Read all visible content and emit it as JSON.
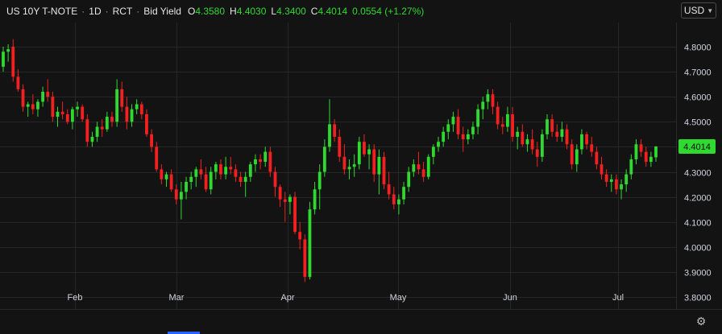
{
  "header": {
    "symbol": "US 10Y T-NOTE",
    "interval": "1D",
    "source": "RCT",
    "price_type": "Bid Yield",
    "open_label": "O",
    "open": "4.3580",
    "high_label": "H",
    "high": "4.4030",
    "low_label": "L",
    "low": "4.3400",
    "close_label": "C",
    "close": "4.4014",
    "change": "0.0554 (+1.27%)",
    "up_color": "#2fd92f",
    "down_color": "#f22020"
  },
  "currency": {
    "label": "USD"
  },
  "settings": {
    "icon": "gear-icon"
  },
  "chart_data": {
    "type": "candlestick",
    "ylim": [
      3.77,
      4.84
    ],
    "y_ticks": [
      "4.8000",
      "4.7000",
      "4.6000",
      "4.5000",
      "4.4000",
      "4.3000",
      "4.2000",
      "4.1000",
      "4.0000",
      "3.9000",
      "3.8000"
    ],
    "x_ticks": [
      "Feb",
      "Mar",
      "Apr",
      "May",
      "Jun",
      "Jul"
    ],
    "last_price_label": "4.4014",
    "last_price": 4.4014,
    "candles": [
      [
        4.72,
        4.8,
        4.7,
        4.78
      ],
      [
        4.78,
        4.81,
        4.74,
        4.79
      ],
      [
        4.8,
        4.83,
        4.66,
        4.68
      ],
      [
        4.68,
        4.71,
        4.62,
        4.63
      ],
      [
        4.63,
        4.65,
        4.54,
        4.56
      ],
      [
        4.56,
        4.58,
        4.52,
        4.57
      ],
      [
        4.57,
        4.61,
        4.53,
        4.55
      ],
      [
        4.55,
        4.59,
        4.52,
        4.58
      ],
      [
        4.58,
        4.64,
        4.56,
        4.62
      ],
      [
        4.62,
        4.67,
        4.58,
        4.6
      ],
      [
        4.6,
        4.62,
        4.5,
        4.52
      ],
      [
        4.52,
        4.56,
        4.48,
        4.54
      ],
      [
        4.54,
        4.58,
        4.51,
        4.53
      ],
      [
        4.53,
        4.55,
        4.49,
        4.5
      ],
      [
        4.5,
        4.56,
        4.47,
        4.55
      ],
      [
        4.55,
        4.58,
        4.52,
        4.56
      ],
      [
        4.56,
        4.57,
        4.5,
        4.51
      ],
      [
        4.51,
        4.53,
        4.4,
        4.42
      ],
      [
        4.42,
        4.46,
        4.4,
        4.44
      ],
      [
        4.44,
        4.5,
        4.42,
        4.48
      ],
      [
        4.48,
        4.51,
        4.44,
        4.47
      ],
      [
        4.47,
        4.54,
        4.46,
        4.52
      ],
      [
        4.52,
        4.54,
        4.48,
        4.5
      ],
      [
        4.5,
        4.67,
        4.48,
        4.63
      ],
      [
        4.63,
        4.66,
        4.54,
        4.56
      ],
      [
        4.56,
        4.6,
        4.47,
        4.5
      ],
      [
        4.5,
        4.57,
        4.48,
        4.55
      ],
      [
        4.55,
        4.59,
        4.53,
        4.57
      ],
      [
        4.57,
        4.58,
        4.51,
        4.53
      ],
      [
        4.53,
        4.55,
        4.44,
        4.45
      ],
      [
        4.45,
        4.47,
        4.38,
        4.4
      ],
      [
        4.4,
        4.42,
        4.3,
        4.31
      ],
      [
        4.31,
        4.33,
        4.25,
        4.27
      ],
      [
        4.27,
        4.3,
        4.24,
        4.29
      ],
      [
        4.29,
        4.31,
        4.22,
        4.23
      ],
      [
        4.23,
        4.25,
        4.17,
        4.19
      ],
      [
        4.19,
        4.26,
        4.11,
        4.22
      ],
      [
        4.22,
        4.28,
        4.19,
        4.26
      ],
      [
        4.26,
        4.3,
        4.23,
        4.28
      ],
      [
        4.28,
        4.32,
        4.24,
        4.31
      ],
      [
        4.31,
        4.35,
        4.27,
        4.29
      ],
      [
        4.29,
        4.32,
        4.22,
        4.23
      ],
      [
        4.23,
        4.32,
        4.21,
        4.3
      ],
      [
        4.3,
        4.34,
        4.27,
        4.33
      ],
      [
        4.33,
        4.35,
        4.27,
        4.29
      ],
      [
        4.29,
        4.36,
        4.27,
        4.32
      ],
      [
        4.32,
        4.36,
        4.29,
        4.31
      ],
      [
        4.31,
        4.33,
        4.26,
        4.28
      ],
      [
        4.28,
        4.3,
        4.24,
        4.26
      ],
      [
        4.26,
        4.3,
        4.2,
        4.28
      ],
      [
        4.28,
        4.34,
        4.26,
        4.33
      ],
      [
        4.33,
        4.37,
        4.3,
        4.35
      ],
      [
        4.35,
        4.37,
        4.31,
        4.34
      ],
      [
        4.34,
        4.4,
        4.32,
        4.38
      ],
      [
        4.38,
        4.4,
        4.28,
        4.3
      ],
      [
        4.3,
        4.32,
        4.2,
        4.24
      ],
      [
        4.24,
        4.25,
        4.16,
        4.19
      ],
      [
        4.19,
        4.22,
        4.1,
        4.18
      ],
      [
        4.18,
        4.21,
        4.13,
        4.2
      ],
      [
        4.2,
        4.22,
        4.05,
        4.06
      ],
      [
        4.06,
        4.1,
        3.99,
        4.03
      ],
      [
        4.03,
        4.05,
        3.86,
        3.88
      ],
      [
        3.88,
        4.18,
        3.87,
        4.15
      ],
      [
        4.15,
        4.26,
        4.13,
        4.23
      ],
      [
        4.23,
        4.33,
        4.15,
        4.3
      ],
      [
        4.3,
        4.43,
        4.28,
        4.4
      ],
      [
        4.4,
        4.59,
        4.38,
        4.49
      ],
      [
        4.49,
        4.51,
        4.42,
        4.44
      ],
      [
        4.44,
        4.47,
        4.34,
        4.36
      ],
      [
        4.36,
        4.41,
        4.29,
        4.31
      ],
      [
        4.31,
        4.35,
        4.27,
        4.32
      ],
      [
        4.32,
        4.37,
        4.28,
        4.33
      ],
      [
        4.33,
        4.44,
        4.31,
        4.42
      ],
      [
        4.42,
        4.45,
        4.36,
        4.37
      ],
      [
        4.37,
        4.41,
        4.31,
        4.39
      ],
      [
        4.39,
        4.41,
        4.26,
        4.29
      ],
      [
        4.29,
        4.39,
        4.21,
        4.36
      ],
      [
        4.36,
        4.38,
        4.23,
        4.25
      ],
      [
        4.25,
        4.3,
        4.19,
        4.21
      ],
      [
        4.21,
        4.24,
        4.15,
        4.17
      ],
      [
        4.17,
        4.21,
        4.13,
        4.19
      ],
      [
        4.19,
        4.26,
        4.17,
        4.24
      ],
      [
        4.24,
        4.32,
        4.22,
        4.3
      ],
      [
        4.3,
        4.35,
        4.28,
        4.33
      ],
      [
        4.33,
        4.38,
        4.29,
        4.31
      ],
      [
        4.31,
        4.34,
        4.26,
        4.28
      ],
      [
        4.28,
        4.37,
        4.27,
        4.36
      ],
      [
        4.36,
        4.41,
        4.33,
        4.4
      ],
      [
        4.4,
        4.44,
        4.38,
        4.42
      ],
      [
        4.42,
        4.48,
        4.4,
        4.46
      ],
      [
        4.46,
        4.51,
        4.43,
        4.49
      ],
      [
        4.49,
        4.54,
        4.46,
        4.52
      ],
      [
        4.52,
        4.55,
        4.43,
        4.45
      ],
      [
        4.45,
        4.48,
        4.38,
        4.43
      ],
      [
        4.43,
        4.47,
        4.41,
        4.45
      ],
      [
        4.45,
        4.5,
        4.43,
        4.48
      ],
      [
        4.48,
        4.57,
        4.45,
        4.55
      ],
      [
        4.55,
        4.6,
        4.51,
        4.58
      ],
      [
        4.58,
        4.63,
        4.55,
        4.61
      ],
      [
        4.61,
        4.63,
        4.53,
        4.56
      ],
      [
        4.56,
        4.58,
        4.47,
        4.49
      ],
      [
        4.49,
        4.52,
        4.45,
        4.48
      ],
      [
        4.48,
        4.56,
        4.46,
        4.53
      ],
      [
        4.53,
        4.56,
        4.42,
        4.44
      ],
      [
        4.44,
        4.48,
        4.39,
        4.46
      ],
      [
        4.46,
        4.49,
        4.4,
        4.41
      ],
      [
        4.41,
        4.45,
        4.38,
        4.43
      ],
      [
        4.43,
        4.47,
        4.37,
        4.39
      ],
      [
        4.39,
        4.42,
        4.32,
        4.36
      ],
      [
        4.36,
        4.47,
        4.34,
        4.45
      ],
      [
        4.45,
        4.53,
        4.43,
        4.51
      ],
      [
        4.51,
        4.53,
        4.44,
        4.46
      ],
      [
        4.46,
        4.49,
        4.42,
        4.44
      ],
      [
        4.44,
        4.5,
        4.42,
        4.47
      ],
      [
        4.47,
        4.49,
        4.39,
        4.41
      ],
      [
        4.41,
        4.43,
        4.31,
        4.33
      ],
      [
        4.33,
        4.41,
        4.3,
        4.39
      ],
      [
        4.39,
        4.47,
        4.37,
        4.45
      ],
      [
        4.45,
        4.46,
        4.39,
        4.41
      ],
      [
        4.41,
        4.44,
        4.36,
        4.38
      ],
      [
        4.38,
        4.4,
        4.31,
        4.33
      ],
      [
        4.33,
        4.36,
        4.27,
        4.29
      ],
      [
        4.29,
        4.31,
        4.24,
        4.26
      ],
      [
        4.26,
        4.29,
        4.22,
        4.27
      ],
      [
        4.27,
        4.29,
        4.21,
        4.23
      ],
      [
        4.23,
        4.27,
        4.19,
        4.25
      ],
      [
        4.25,
        4.31,
        4.22,
        4.29
      ],
      [
        4.29,
        4.37,
        4.27,
        4.35
      ],
      [
        4.35,
        4.43,
        4.33,
        4.41
      ],
      [
        4.41,
        4.43,
        4.36,
        4.38
      ],
      [
        4.38,
        4.4,
        4.32,
        4.34
      ],
      [
        4.34,
        4.38,
        4.32,
        4.36
      ],
      [
        4.358,
        4.403,
        4.34,
        4.4014
      ]
    ]
  }
}
